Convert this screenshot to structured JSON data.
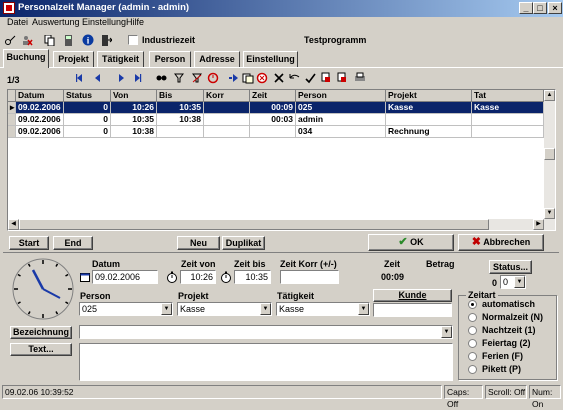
{
  "window": {
    "title": "Personalzeit Manager (admin - admin)"
  },
  "menu": [
    "Datei",
    "Auswertung",
    "Einstellung",
    "Hilfe"
  ],
  "toolbar": {
    "checkbox_label": "Industriezeit",
    "program_label": "Testprogramm"
  },
  "tabs": [
    "Buchung",
    "Projekt",
    "Tätigkeit",
    "Person",
    "Adresse",
    "Einstellung"
  ],
  "record_nav": {
    "counter": "1/3"
  },
  "grid": {
    "columns": [
      "Datum",
      "Status",
      "Von",
      "Bis",
      "Korr",
      "Zeit",
      "Person",
      "Projekt",
      "Tat"
    ],
    "rows": [
      [
        "09.02.2006",
        "0",
        "10:26",
        "10:35",
        "",
        "00:09",
        "025",
        "Kasse",
        "Kasse"
      ],
      [
        "09.02.2006",
        "0",
        "10:35",
        "10:38",
        "",
        "00:03",
        "admin",
        "",
        ""
      ],
      [
        "09.02.2006",
        "0",
        "10:38",
        "",
        "",
        "",
        "034",
        "Rechnung",
        ""
      ]
    ]
  },
  "buttons": {
    "start": "Start",
    "end": "End",
    "neu": "Neu",
    "duplikat": "Duplikat",
    "ok": "OK",
    "abbrechen": "Abbrechen",
    "status": "Status...",
    "kunde": "Kunde",
    "bezeichnung": "Bezeichnung",
    "text": "Text..."
  },
  "form": {
    "datum_label": "Datum",
    "datum_value": "09.02.2006",
    "zeit_von_label": "Zeit von",
    "zeit_von_value": "10:26",
    "zeit_bis_label": "Zeit bis",
    "zeit_bis_value": "10:35",
    "zeit_korr_label": "Zeit Korr (+/-)",
    "zeit_korr_value": "",
    "zeit_label": "Zeit",
    "zeit_value": "00:09",
    "betrag_label": "Betrag",
    "status_value_a": "0",
    "status_value_b": "0",
    "person_label": "Person",
    "person_value": "025",
    "projekt_label": "Projekt",
    "projekt_value": "Kasse",
    "taetigkeit_label": "Tätigkeit",
    "taetigkeit_value": "Kasse",
    "kunde_value": "",
    "bezeichnung_value": "",
    "text_value": ""
  },
  "zeitart": {
    "title": "Zeitart",
    "options": [
      "automatisch",
      "Normalzeit (N)",
      "Nachtzeit (1)",
      "Feiertag (2)",
      "Ferien (F)",
      "Pikett (P)"
    ],
    "selected": 0
  },
  "statusbar": [
    "09.02.06 10:39:52",
    "Caps: Off",
    "Scroll: Off",
    "Num: On"
  ],
  "colors": {
    "title_bar": "#0a246a",
    "selection": "#0a246a",
    "ok_check": "#2a8a2a",
    "cancel_x": "#c00000",
    "clock_hands": "#1a3aa8"
  }
}
